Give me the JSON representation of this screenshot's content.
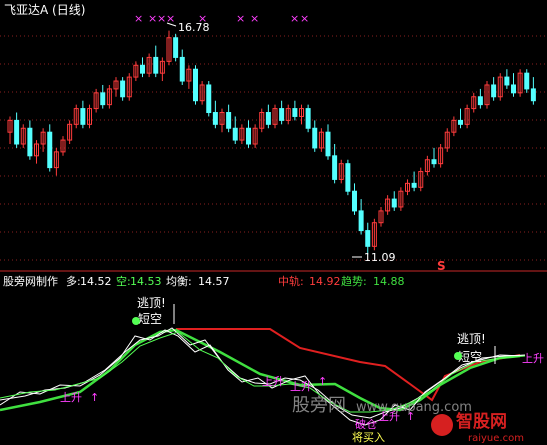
{
  "colors": {
    "background": "#000000",
    "up_candle": "#ff3c3c",
    "down_candle": "#54ffff",
    "divider": "#c82828",
    "magenta": "#ff40ff",
    "white": "#ffffff",
    "title": "#ffffff",
    "dot_line": "#8a2020",
    "trend_red": "#e02020",
    "trend_green": "#40e040",
    "yellow": "#ffff54"
  },
  "header": {
    "title": "飞亚达A (日线)"
  },
  "main_panel": {
    "high_label": "16.78",
    "low_label": "11.09",
    "s_mark": "S",
    "x_markers": [
      "×",
      "×",
      "×",
      "×",
      "×",
      "×",
      "×",
      "×",
      "×"
    ]
  },
  "indicator_bar": {
    "source": "股旁网制作",
    "duo_label": "多:",
    "duo_value": "14.52",
    "kong_label": "空:",
    "kong_value": "14.53",
    "junheng_label": "均衡:",
    "junheng_value": "14.57",
    "zhonggui_label": "中轨:",
    "zhonggui_value": "14.92",
    "qushi_label": "趋势:",
    "qushi_value": "14.88"
  },
  "lower_panel": {
    "signals": {
      "taoding_1": "逃顶!",
      "duankong_1": "短空",
      "taoding_2": "逃顶!",
      "duankong_2": "短空",
      "shangsheng_1": "上升",
      "shangsheng_2": "上升",
      "shangsheng_3": "上升",
      "shangsheng_4": "上升",
      "shangsheng_5": "上升",
      "pocang": "破仓",
      "jiangmairu": "将买入"
    }
  },
  "watermarks": {
    "site_cn": "股旁网",
    "site_url": "www.gupang.com",
    "logo_text": "智股网",
    "logo_url": "raiyue.com"
  },
  "chart_data": [
    {
      "type": "candlestick",
      "title": "飞亚达A (日线)",
      "annotations": [
        {
          "text": "16.78",
          "type": "high"
        },
        {
          "text": "11.09",
          "type": "low"
        }
      ],
      "price_range": [
        11.09,
        16.78
      ],
      "candles": [
        [
          14.2,
          14.6,
          13.9,
          14.5
        ],
        [
          14.5,
          14.7,
          13.8,
          13.9
        ],
        [
          13.9,
          14.4,
          13.8,
          14.3
        ],
        [
          14.3,
          14.5,
          13.5,
          13.6
        ],
        [
          13.6,
          14.0,
          13.4,
          13.9
        ],
        [
          13.9,
          14.3,
          13.7,
          14.2
        ],
        [
          14.2,
          14.4,
          13.2,
          13.3
        ],
        [
          13.3,
          13.8,
          13.1,
          13.7
        ],
        [
          13.7,
          14.1,
          13.6,
          14.0
        ],
        [
          14.0,
          14.5,
          13.9,
          14.4
        ],
        [
          14.4,
          14.9,
          14.3,
          14.8
        ],
        [
          14.8,
          15.0,
          14.3,
          14.4
        ],
        [
          14.4,
          14.9,
          14.3,
          14.8
        ],
        [
          14.8,
          15.3,
          14.7,
          15.2
        ],
        [
          15.2,
          15.4,
          14.8,
          14.9
        ],
        [
          14.9,
          15.4,
          14.8,
          15.3
        ],
        [
          15.3,
          15.6,
          15.1,
          15.5
        ],
        [
          15.5,
          15.6,
          15.0,
          15.1
        ],
        [
          15.1,
          15.7,
          15.0,
          15.6
        ],
        [
          15.6,
          16.0,
          15.5,
          15.9
        ],
        [
          15.9,
          16.1,
          15.6,
          15.7
        ],
        [
          15.7,
          16.2,
          15.6,
          16.1
        ],
        [
          16.1,
          16.4,
          15.6,
          15.7
        ],
        [
          15.7,
          16.1,
          15.5,
          16.0
        ],
        [
          16.0,
          16.78,
          15.9,
          16.6
        ],
        [
          16.6,
          16.7,
          16.0,
          16.1
        ],
        [
          16.1,
          16.3,
          15.4,
          15.5
        ],
        [
          15.5,
          15.9,
          15.3,
          15.8
        ],
        [
          15.8,
          15.9,
          14.9,
          15.0
        ],
        [
          15.0,
          15.5,
          14.9,
          15.4
        ],
        [
          15.4,
          15.5,
          14.6,
          14.7
        ],
        [
          14.7,
          15.0,
          14.3,
          14.4
        ],
        [
          14.4,
          14.8,
          14.2,
          14.7
        ],
        [
          14.7,
          14.9,
          14.2,
          14.3
        ],
        [
          14.3,
          14.6,
          13.9,
          14.0
        ],
        [
          14.0,
          14.4,
          13.9,
          14.3
        ],
        [
          14.3,
          14.5,
          13.8,
          13.9
        ],
        [
          13.9,
          14.4,
          13.8,
          14.3
        ],
        [
          14.3,
          14.8,
          14.2,
          14.7
        ],
        [
          14.7,
          14.9,
          14.3,
          14.4
        ],
        [
          14.4,
          14.9,
          14.3,
          14.8
        ],
        [
          14.8,
          15.0,
          14.4,
          14.5
        ],
        [
          14.5,
          14.9,
          14.4,
          14.8
        ],
        [
          14.8,
          15.0,
          14.5,
          14.6
        ],
        [
          14.6,
          14.9,
          14.4,
          14.8
        ],
        [
          14.8,
          14.9,
          14.2,
          14.3
        ],
        [
          14.3,
          14.5,
          13.7,
          13.8
        ],
        [
          13.8,
          14.3,
          13.7,
          14.2
        ],
        [
          14.2,
          14.4,
          13.5,
          13.6
        ],
        [
          13.6,
          13.9,
          12.9,
          13.0
        ],
        [
          13.0,
          13.5,
          12.9,
          13.4
        ],
        [
          13.4,
          13.5,
          12.6,
          12.7
        ],
        [
          12.7,
          12.9,
          12.1,
          12.2
        ],
        [
          12.2,
          12.5,
          11.6,
          11.7
        ],
        [
          11.7,
          11.9,
          11.09,
          11.3
        ],
        [
          11.3,
          12.0,
          11.2,
          11.9
        ],
        [
          11.9,
          12.3,
          11.8,
          12.2
        ],
        [
          12.2,
          12.6,
          12.1,
          12.5
        ],
        [
          12.5,
          12.7,
          12.2,
          12.3
        ],
        [
          12.3,
          12.8,
          12.2,
          12.7
        ],
        [
          12.7,
          13.0,
          12.6,
          12.9
        ],
        [
          12.9,
          13.2,
          12.7,
          12.8
        ],
        [
          12.8,
          13.3,
          12.7,
          13.2
        ],
        [
          13.2,
          13.6,
          13.1,
          13.5
        ],
        [
          13.5,
          13.8,
          13.3,
          13.4
        ],
        [
          13.4,
          13.9,
          13.3,
          13.8
        ],
        [
          13.8,
          14.3,
          13.7,
          14.2
        ],
        [
          14.2,
          14.6,
          14.1,
          14.5
        ],
        [
          14.5,
          14.8,
          14.3,
          14.4
        ],
        [
          14.4,
          14.9,
          14.3,
          14.8
        ],
        [
          14.8,
          15.2,
          14.7,
          15.1
        ],
        [
          15.1,
          15.3,
          14.8,
          14.9
        ],
        [
          14.9,
          15.5,
          14.8,
          15.4
        ],
        [
          15.4,
          15.6,
          15.0,
          15.1
        ],
        [
          15.1,
          15.7,
          15.0,
          15.6
        ],
        [
          15.6,
          15.8,
          15.3,
          15.4
        ],
        [
          15.4,
          15.7,
          15.1,
          15.2
        ],
        [
          15.2,
          15.8,
          15.1,
          15.7
        ],
        [
          15.7,
          15.8,
          15.2,
          15.3
        ],
        [
          15.3,
          15.6,
          14.9,
          15.0
        ]
      ]
    },
    {
      "type": "line",
      "series": [
        {
          "name": "多",
          "color": "#ffffff",
          "last_value": 14.52
        },
        {
          "name": "空",
          "color": "#54ff54",
          "last_value": 14.53
        },
        {
          "name": "均衡",
          "color": "#ffffff",
          "last_value": 14.57
        },
        {
          "name": "中轨",
          "color": "#e02020",
          "last_value": 14.92
        },
        {
          "name": "趋势",
          "color": "#40e040",
          "last_value": 14.88
        }
      ]
    }
  ]
}
